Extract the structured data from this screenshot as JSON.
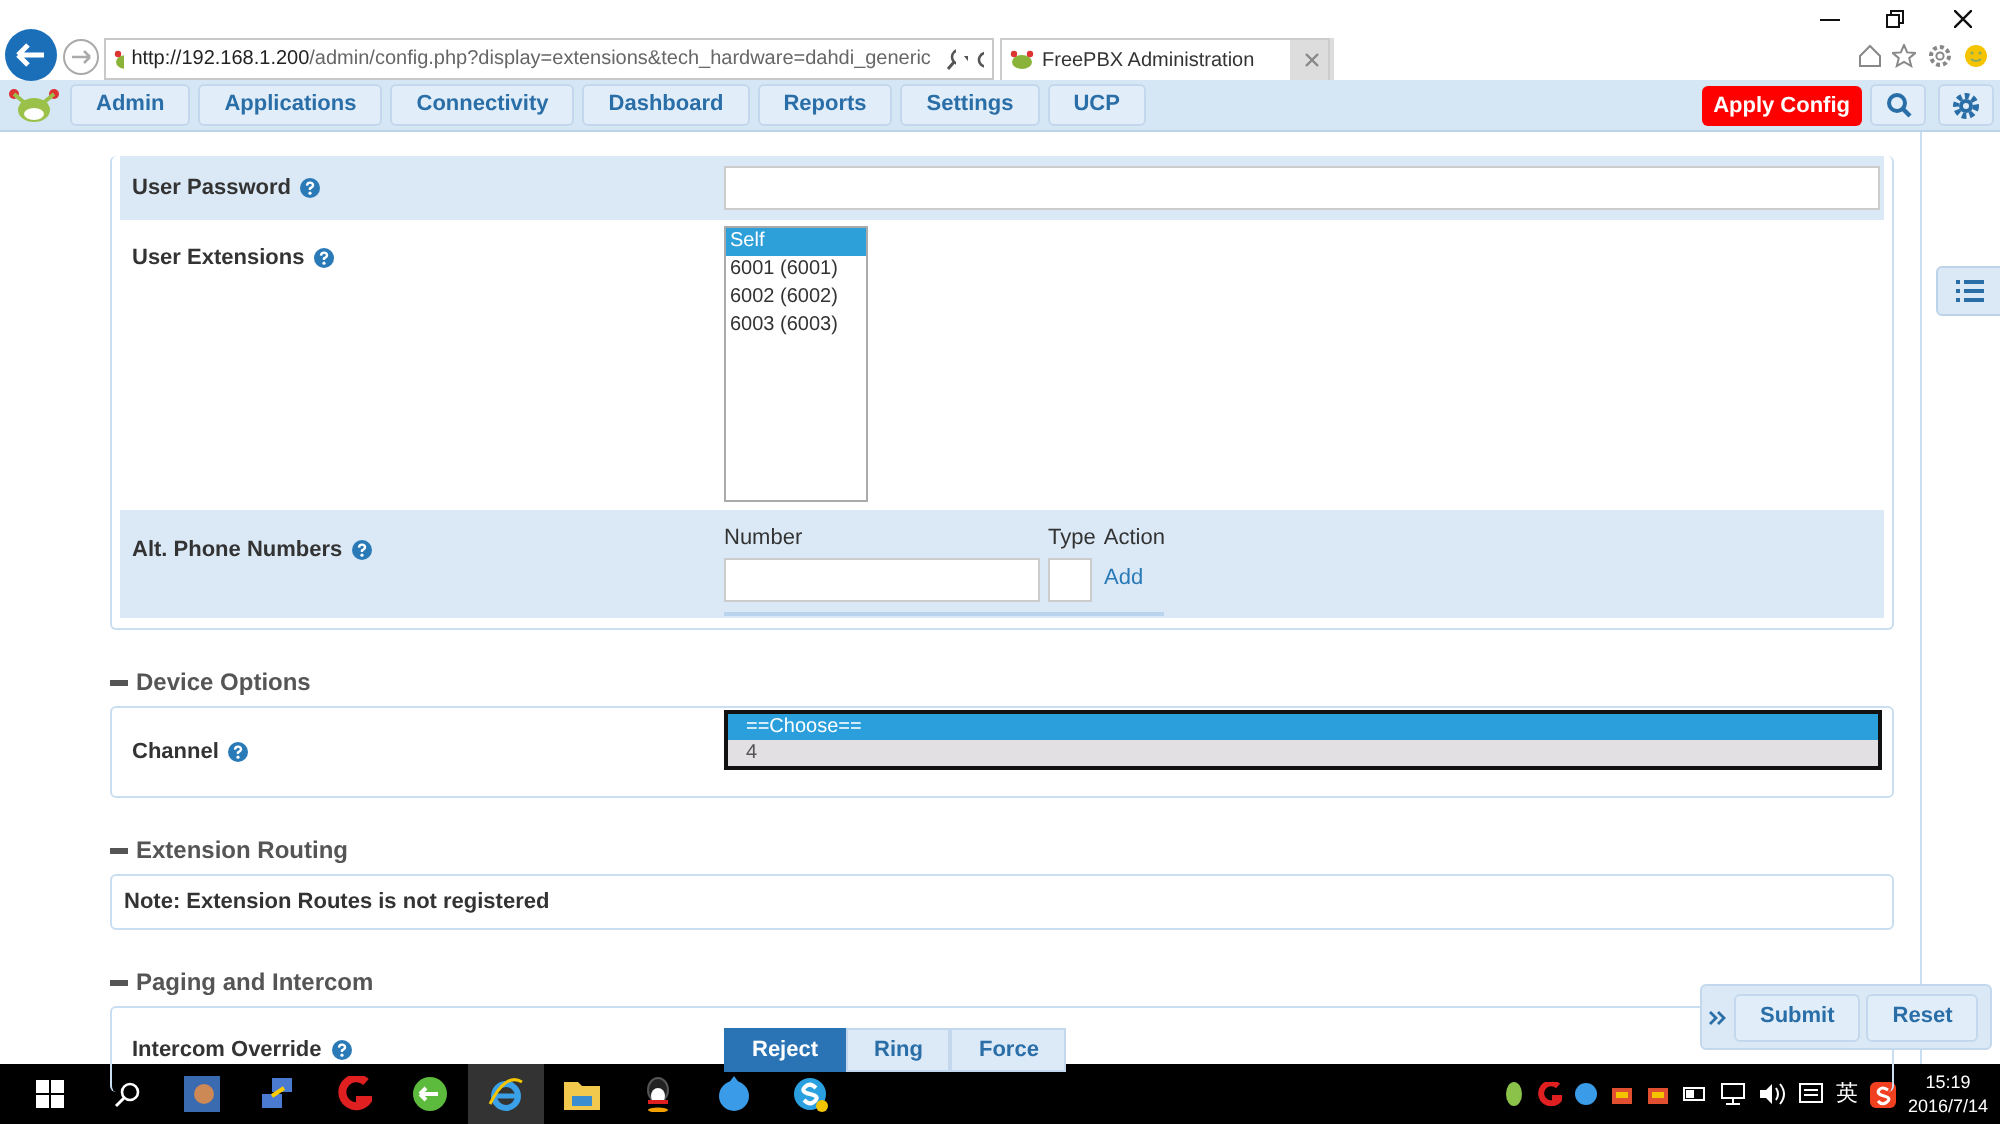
{
  "browser": {
    "url_host": "http://192.168.1.200",
    "url_path": "/admin/config.php?display=extensions&tech_hardware=dahdi_generic",
    "tab_title": "FreePBX Administration"
  },
  "nav": {
    "items": [
      {
        "label": "Admin"
      },
      {
        "label": "Applications"
      },
      {
        "label": "Connectivity"
      },
      {
        "label": "Dashboard"
      },
      {
        "label": "Reports"
      },
      {
        "label": "Settings"
      },
      {
        "label": "UCP"
      }
    ],
    "apply": "Apply Config"
  },
  "user_section": {
    "password_label": "User Password",
    "extensions_label": "User Extensions",
    "extensions": [
      {
        "label": "Self",
        "selected": true
      },
      {
        "label": "6001 (6001)",
        "selected": false
      },
      {
        "label": "6002 (6002)",
        "selected": false
      },
      {
        "label": "6003 (6003)",
        "selected": false
      }
    ],
    "alt_label": "Alt. Phone Numbers",
    "alt_columns": [
      "Number",
      "Type",
      "Action"
    ],
    "add_link": "Add"
  },
  "device_options": {
    "title": "Device Options",
    "channel_label": "Channel",
    "channel_options": [
      {
        "label": "==Choose==",
        "selected": true
      },
      {
        "label": "4",
        "selected": false
      }
    ]
  },
  "extension_routing": {
    "title": "Extension Routing",
    "note": "Note: Extension Routes is not registered"
  },
  "paging": {
    "title": "Paging and Intercom",
    "override_label": "Intercom Override",
    "options": [
      {
        "label": "Reject",
        "selected": true
      },
      {
        "label": "Ring",
        "selected": false
      },
      {
        "label": "Force",
        "selected": false
      }
    ]
  },
  "actions": [
    "Submit",
    "Reset"
  ],
  "taskbar": {
    "ime": "英",
    "time": "15:19",
    "date": "2016/7/14"
  }
}
